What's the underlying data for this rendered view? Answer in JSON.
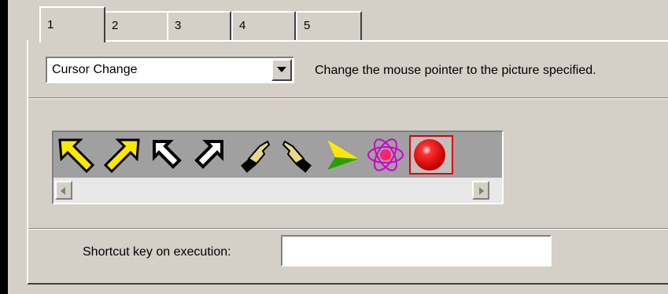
{
  "tabs": [
    {
      "label": "1",
      "active": true
    },
    {
      "label": "2",
      "active": false
    },
    {
      "label": "3",
      "active": false
    },
    {
      "label": "4",
      "active": false
    },
    {
      "label": "5",
      "active": false
    }
  ],
  "action": {
    "selected": "Cursor Change",
    "description": "Change the mouse pointer to the picture specified."
  },
  "cursors": [
    {
      "name": "yellow-arrow-up-left-icon"
    },
    {
      "name": "yellow-arrow-up-right-icon"
    },
    {
      "name": "outline-arrow-up-left-icon"
    },
    {
      "name": "outline-arrow-up-right-icon"
    },
    {
      "name": "pointing-hand-left-icon"
    },
    {
      "name": "pointing-hand-right-icon"
    },
    {
      "name": "green-triangle-pointer-icon"
    },
    {
      "name": "atom-pointer-icon"
    },
    {
      "name": "red-ball-pointer-icon",
      "selected": true
    }
  ],
  "shortcut": {
    "label": "Shortcut key on execution:",
    "value": ""
  },
  "colors": {
    "panel": "#d4d0c8",
    "selection": "#e00000"
  }
}
